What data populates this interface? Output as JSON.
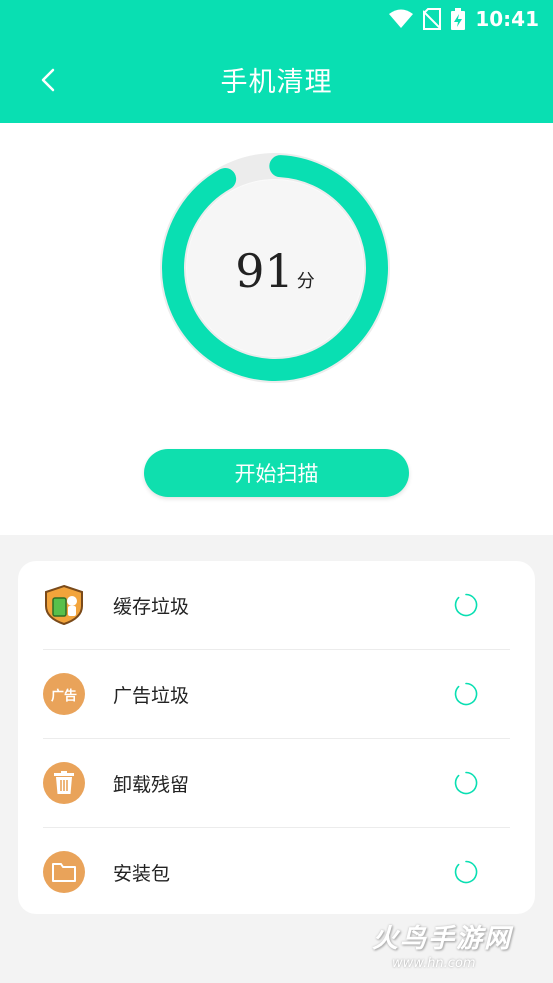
{
  "status_bar": {
    "time": "10:41"
  },
  "header": {
    "title": "手机清理"
  },
  "score": {
    "value": "91",
    "unit": "分",
    "progress": 0.91
  },
  "scan_button": {
    "label": "开始扫描"
  },
  "items": [
    {
      "label": "缓存垃圾",
      "icon": "cache-shield-icon"
    },
    {
      "label": "广告垃圾",
      "icon": "ad-icon",
      "icon_text": "广告"
    },
    {
      "label": "卸载残留",
      "icon": "trash-icon"
    },
    {
      "label": "安装包",
      "icon": "folder-icon"
    }
  ],
  "watermark": {
    "text": "火鸟手游网",
    "sub": "www.hn.com"
  },
  "colors": {
    "accent": "#09dfb2",
    "icon_orange": "#e9a35a",
    "background": "#f3f3f3"
  }
}
